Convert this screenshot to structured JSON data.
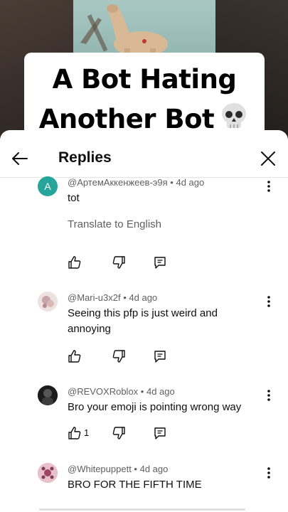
{
  "video": {
    "caption_line1": "A Bot Hating",
    "caption_line2": "Another Bot"
  },
  "sheet": {
    "title": "Replies"
  },
  "comments": [
    {
      "author": "@АртемАккенжеев-э9я",
      "age": "4d ago",
      "text": "tot",
      "translate": "Translate to English",
      "avatar_letter": "A",
      "avatar_color": "#26a69a",
      "likes": ""
    },
    {
      "author": "@Mari-u3x2f",
      "age": "4d ago",
      "text": "Seeing this pfp is just weird and annoying",
      "likes": ""
    },
    {
      "author": "@REVOXRoblox",
      "age": "4d ago",
      "text": "Bro your emoji is pointing wrong way",
      "likes": "1"
    },
    {
      "author": "@Whitepuppett",
      "age": "4d ago",
      "text": "BRO FOR THE FIFTH TIME",
      "likes": ""
    }
  ],
  "separator": " • ",
  "colors": {
    "text": "#0f0f0f",
    "secondary": "#606060",
    "divider": "#e5e5e5"
  }
}
